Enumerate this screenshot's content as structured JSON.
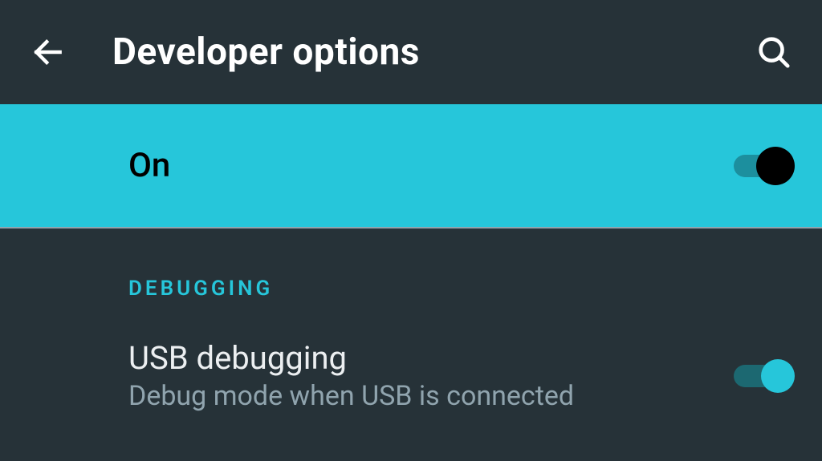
{
  "appbar": {
    "title": "Developer options"
  },
  "master_toggle": {
    "label": "On",
    "state": true
  },
  "sections": {
    "debugging": {
      "header": "DEBUGGING",
      "usb_debugging": {
        "title": "USB debugging",
        "subtitle": "Debug mode when USB is connected",
        "state": true
      }
    }
  },
  "colors": {
    "accent": "#26c6da",
    "background": "#263238"
  }
}
